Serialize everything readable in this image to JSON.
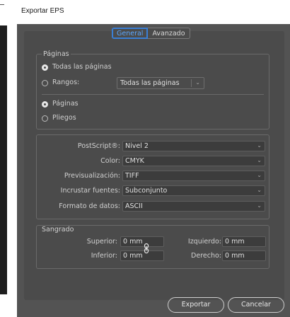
{
  "window": {
    "title": "Exportar EPS"
  },
  "tabs": [
    {
      "label": "General",
      "active": true
    },
    {
      "label": "Avanzado",
      "active": false
    }
  ],
  "pages": {
    "legend": "Páginas",
    "all_pages_label": "Todas las páginas",
    "ranges_label": "Rangos:",
    "ranges_value": "Todas las páginas",
    "pages_label": "Páginas",
    "spreads_label": "Pliegos"
  },
  "settings": {
    "postscript": {
      "label": "PostScript®:",
      "value": "Nivel 2"
    },
    "color": {
      "label": "Color:",
      "value": "CMYK"
    },
    "preview": {
      "label": "Previsualización:",
      "value": "TIFF"
    },
    "embed_fonts": {
      "label": "Incrustar fuentes:",
      "value": "Subconjunto"
    },
    "data_format": {
      "label": "Formato de datos:",
      "value": "ASCII"
    }
  },
  "bleed": {
    "legend": "Sangrado",
    "top_label": "Superior:",
    "top_value": "0 mm",
    "bottom_label": "Inferior:",
    "bottom_value": "0 mm",
    "left_label": "Izquierdo:",
    "left_value": "0 mm",
    "right_label": "Derecho:",
    "right_value": "0 mm"
  },
  "buttons": {
    "export": "Exportar",
    "cancel": "Cancelar"
  },
  "icons": {
    "chevron": "chevron-down-icon",
    "link": "link-icon"
  },
  "colors": {
    "accent": "#3a7fd5",
    "panel": "#4b4b4b",
    "window": "#535353"
  }
}
